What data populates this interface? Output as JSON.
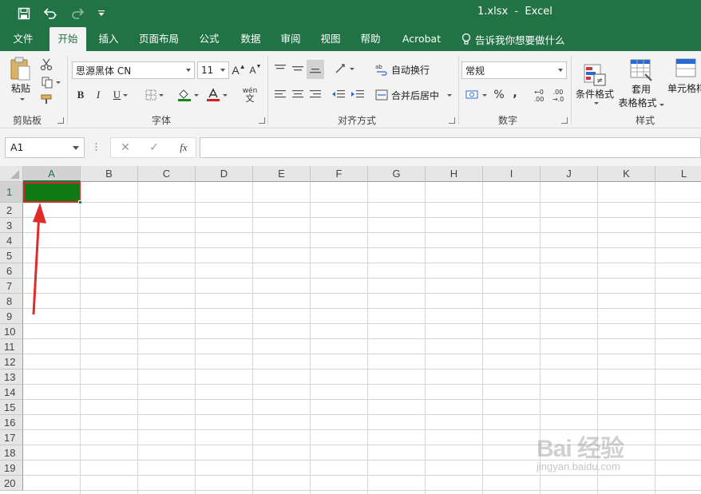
{
  "window": {
    "title": "1.xlsx  -  Excel"
  },
  "qat": {
    "save_icon": "save-icon",
    "undo_icon": "undo-icon",
    "redo_icon": "redo-icon",
    "customize_icon": "customize-qat-icon"
  },
  "tabs": [
    {
      "label": "文件"
    },
    {
      "label": "开始"
    },
    {
      "label": "插入"
    },
    {
      "label": "页面布局"
    },
    {
      "label": "公式"
    },
    {
      "label": "数据"
    },
    {
      "label": "审阅"
    },
    {
      "label": "视图"
    },
    {
      "label": "帮助"
    },
    {
      "label": "Acrobat"
    }
  ],
  "active_tab": "开始",
  "tell_me": {
    "label": "告诉我你想要做什么"
  },
  "ribbon": {
    "clipboard": {
      "paste_label": "粘贴",
      "group_label": "剪贴板"
    },
    "font": {
      "font_name": "思源黑体 CN",
      "font_size": "11",
      "bold": "B",
      "italic": "I",
      "underline": "U",
      "grow": "A",
      "shrink": "A",
      "wen": "wén",
      "wen_char": "文",
      "group_label": "字体"
    },
    "alignment": {
      "wrap_text": "自动换行",
      "merge_center": "合并后居中",
      "group_label": "对齐方式"
    },
    "number": {
      "format": "常规",
      "percent": "%",
      "comma": ",",
      "inc_decimal_top": "←0",
      "inc_decimal_bottom": ".00",
      "dec_decimal_top": ".00",
      "dec_decimal_bottom": "→.0",
      "group_label": "数字"
    },
    "styles": {
      "conditional_format": "条件格式",
      "format_as_table_1": "套用",
      "format_as_table_2": "表格格式",
      "cell_styles": "单元格样",
      "group_label": "样式"
    }
  },
  "formula_bar": {
    "name_box": "A1",
    "cancel": "✕",
    "enter": "✓",
    "fx": "fx",
    "value": ""
  },
  "grid": {
    "columns": [
      "A",
      "B",
      "C",
      "D",
      "E",
      "F",
      "G",
      "H",
      "I",
      "J",
      "K",
      "L"
    ],
    "rows": [
      "1",
      "2",
      "3",
      "4",
      "5",
      "6",
      "7",
      "8",
      "9",
      "10",
      "11",
      "12",
      "13",
      "14",
      "15",
      "16",
      "17",
      "18",
      "19",
      "20"
    ],
    "selected_cell": "A1",
    "a1_fill_color": "#0d7a12",
    "a1_border_color": "#d12a2a"
  },
  "colors": {
    "excel_green": "#217346",
    "annotation_red": "#e02b2b"
  },
  "watermark": {
    "brand": "Bai 经验",
    "sub": "jingyan.baidu.com"
  }
}
